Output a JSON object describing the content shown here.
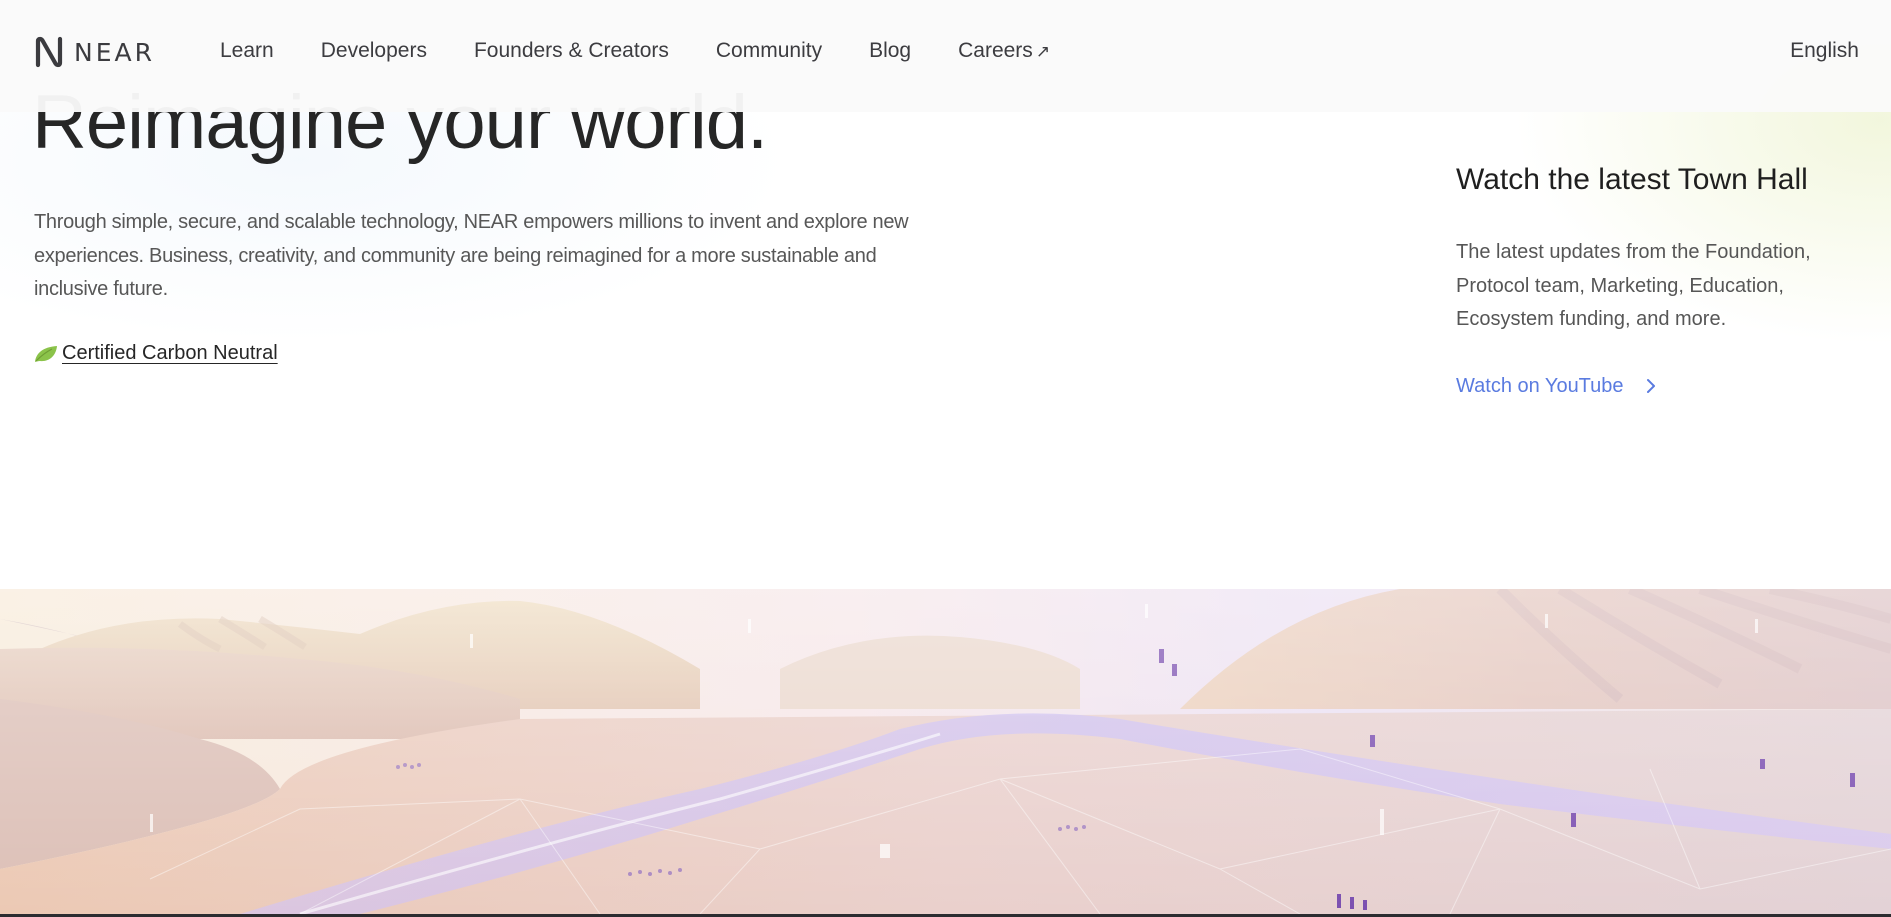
{
  "header": {
    "logo": {
      "word": "NEAR",
      "icon": "near-logo-icon"
    },
    "nav": [
      {
        "label": "Learn"
      },
      {
        "label": "Developers"
      },
      {
        "label": "Founders & Creators"
      },
      {
        "label": "Community"
      },
      {
        "label": "Blog"
      },
      {
        "label": "Careers",
        "external_icon": "↗"
      }
    ],
    "language": "English"
  },
  "hero": {
    "title": "Reimagine your world.",
    "description": "Through simple, secure, and scalable technology, NEAR empowers millions to invent and explore new experiences. Business, creativity, and community are being reimagined for a more sustainable and inclusive future.",
    "carbon": {
      "label": "Certified Carbon Neutral",
      "icon": "leaf-icon",
      "icon_color": "#8bc34a"
    }
  },
  "townhall": {
    "title": "Watch the latest Town Hall",
    "description": "The latest updates from the Foundation, Protocol team, Marketing, Education, Ecosystem funding, and more.",
    "link_label": "Watch on YouTube",
    "link_icon": "chevron-right-icon",
    "link_color": "#5a7be0"
  },
  "landscape": {
    "alt": "Illustrated desert landscape with dunes, a glowing river and a network grid"
  }
}
